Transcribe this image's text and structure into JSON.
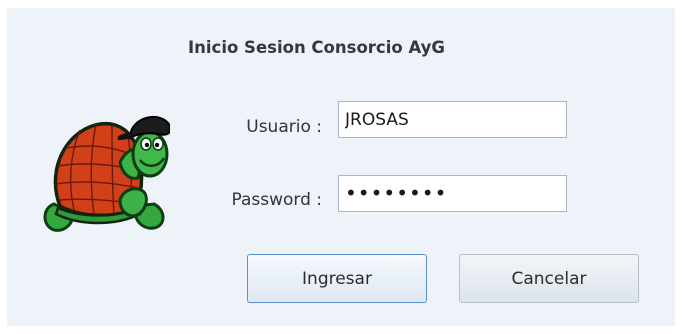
{
  "dialog": {
    "title": "Inicio Sesion Consorcio AyG",
    "logo_icon": "turtle-mascot-icon"
  },
  "form": {
    "user_label": "Usuario :",
    "user_value": "JROSAS",
    "password_label": "Password :",
    "password_value": "••••••••"
  },
  "buttons": {
    "login_label": "Ingresar",
    "cancel_label": "Cancelar"
  },
  "colors": {
    "dialog_background": "#eef2f9",
    "shell_green": "#2e9a3a",
    "shell_orange": "#d2401a",
    "focus_border": "#5f8fcb"
  }
}
